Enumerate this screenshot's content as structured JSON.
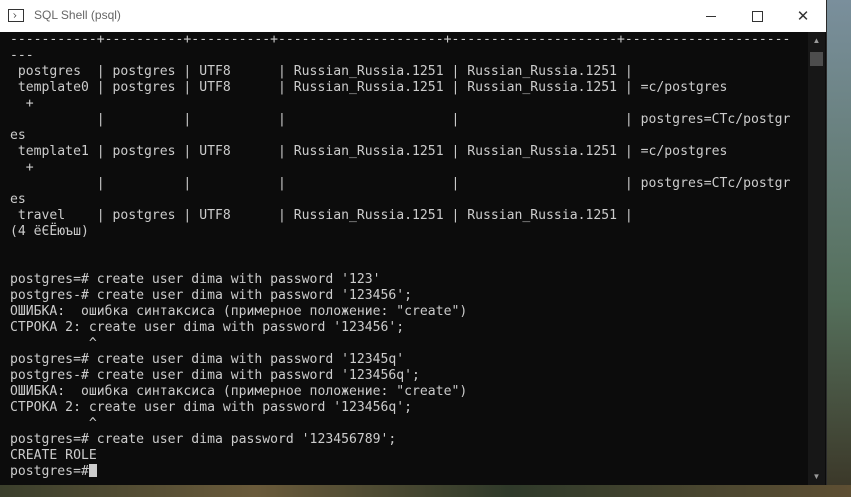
{
  "window": {
    "title": "SQL Shell (psql)",
    "minimize_glyph": "",
    "maximize_glyph": "",
    "close_glyph": "✕"
  },
  "terminal": {
    "lines": [
      "-----------+----------+----------+---------------------+---------------------+---------------------",
      "---",
      " postgres  | postgres | UTF8      | Russian_Russia.1251 | Russian_Russia.1251 |",
      " template0 | postgres | UTF8      | Russian_Russia.1251 | Russian_Russia.1251 | =c/postgres",
      "  +",
      "           |          |           |                     |                     | postgres=CTc/postgr",
      "es",
      " template1 | postgres | UTF8      | Russian_Russia.1251 | Russian_Russia.1251 | =c/postgres",
      "  +",
      "           |          |           |                     |                     | postgres=CTc/postgr",
      "es",
      " travel    | postgres | UTF8      | Russian_Russia.1251 | Russian_Russia.1251 |",
      "(4 ёЄЁюъш)",
      "",
      "",
      "postgres=# create user dima with password '123'",
      "postgres-# create user dima with password '123456';",
      "ОШИБКА:  ошибка синтаксиса (примерное положение: \"create\")",
      "СТРОКА 2: create user dima with password '123456';",
      "          ^",
      "postgres=# create user dima with password '12345q'",
      "postgres-# create user dima with password '123456q';",
      "ОШИБКА:  ошибка синтаксиса (примерное положение: \"create\")",
      "СТРОКА 2: create user dima with password '123456q';",
      "          ^",
      "postgres=# create user dima password '123456789';",
      "CREATE ROLE",
      "postgres=#"
    ]
  },
  "scrollbar": {
    "up_icon": "▲",
    "down_icon": "▼"
  }
}
